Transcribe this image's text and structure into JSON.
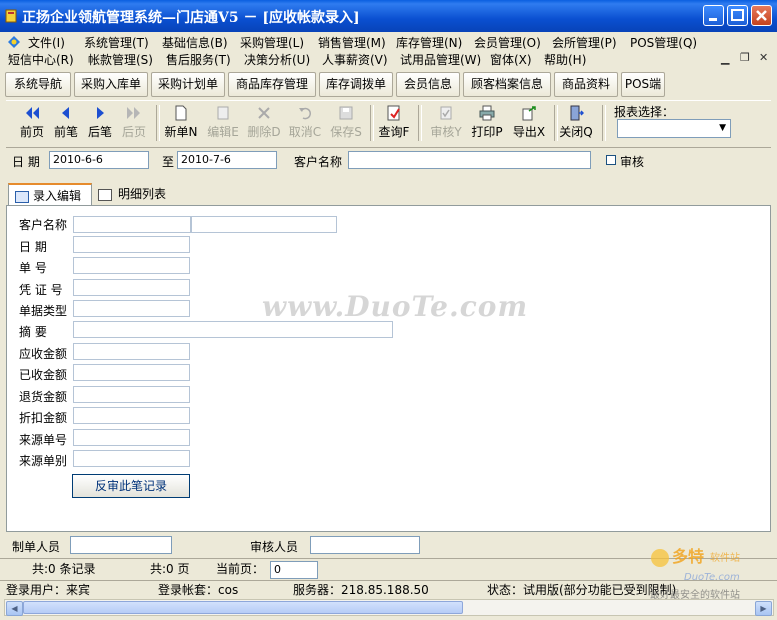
{
  "window": {
    "title": "正扬企业领航管理系统—门店通V5 － [应收帐款录入]"
  },
  "menu": {
    "row1": [
      {
        "label": "文件(I)",
        "key": "file"
      },
      {
        "label": "系统管理(T)",
        "key": "system"
      },
      {
        "label": "基础信息(B)",
        "key": "basic"
      },
      {
        "label": "采购管理(L)",
        "key": "purchase"
      },
      {
        "label": "销售管理(M)",
        "key": "sales"
      },
      {
        "label": "库存管理(N)",
        "key": "stock"
      },
      {
        "label": "会员管理(O)",
        "key": "member"
      },
      {
        "label": "会所管理(P)",
        "key": "club"
      },
      {
        "label": "POS管理(Q)",
        "key": "pos"
      }
    ],
    "row2": [
      {
        "label": "短信中心(R)",
        "key": "sms"
      },
      {
        "label": "帐款管理(S)",
        "key": "accounts"
      },
      {
        "label": "售后服务(T)",
        "key": "aftersales"
      },
      {
        "label": "决策分析(U)",
        "key": "analysis"
      },
      {
        "label": "人事薪资(V)",
        "key": "hr"
      },
      {
        "label": "试用品管理(W)",
        "key": "trial"
      },
      {
        "label": "窗体(X)",
        "key": "window"
      },
      {
        "label": "帮助(H)",
        "key": "help"
      }
    ]
  },
  "nav_tabs": [
    "系统导航",
    "采购入库单",
    "采购计划单",
    "商品库存管理",
    "库存调拨单",
    "会员信息",
    "顾客档案信息",
    "商品资料",
    "POS端"
  ],
  "toolbar": {
    "buttons": [
      {
        "label": "前页",
        "icon": "double-left-arrow-icon",
        "enabled": true
      },
      {
        "label": "前笔",
        "icon": "left-arrow-icon",
        "enabled": true
      },
      {
        "label": "后笔",
        "icon": "right-arrow-icon",
        "enabled": true
      },
      {
        "label": "后页",
        "icon": "double-right-arrow-icon",
        "enabled": false
      },
      {
        "label": "新单N",
        "icon": "new-doc-icon",
        "enabled": true
      },
      {
        "label": "编辑E",
        "icon": "edit-icon",
        "enabled": false
      },
      {
        "label": "删除D",
        "icon": "delete-icon",
        "enabled": false
      },
      {
        "label": "取消C",
        "icon": "undo-icon",
        "enabled": false
      },
      {
        "label": "保存S",
        "icon": "save-icon",
        "enabled": false
      },
      {
        "label": "查询F",
        "icon": "query-icon",
        "enabled": true
      },
      {
        "label": "审核Y",
        "icon": "approve-icon",
        "enabled": false
      },
      {
        "label": "打印P",
        "icon": "print-icon",
        "enabled": true
      },
      {
        "label": "导出X",
        "icon": "export-icon",
        "enabled": true
      },
      {
        "label": "关闭Q",
        "icon": "close-door-icon",
        "enabled": true
      }
    ],
    "report_select_label": "报表选择：",
    "report_select_value": ""
  },
  "filter": {
    "date_label": "日  期",
    "date_from": "2010-6-6",
    "to_label": "至",
    "date_to": "2010-7-6",
    "customer_label": "客户名称",
    "customer_value": "",
    "audit_label": "审核"
  },
  "tabs": {
    "edit": "录入编辑",
    "detail": "明细列表"
  },
  "form": {
    "customer": "客户名称",
    "date": "日    期",
    "number": "单    号",
    "voucher": "凭 证 号",
    "doc_type": "单据类型",
    "summary": "摘    要",
    "receivable": "应收金额",
    "received": "已收金额",
    "returned": "退货金额",
    "discount": "折扣金额",
    "source_no": "来源单号",
    "source_type": "来源单别",
    "review_button": "反审此笔记录"
  },
  "watermark": "www.DuoTe.com",
  "footer": {
    "creator_label": "制单人员",
    "auditor_label": "审核人员",
    "total_records": "共:0 条记录",
    "total_pages": "共:0 页",
    "current_page_label": "当前页：",
    "current_page": "0",
    "login_user": "登录用户：来宾",
    "login_account": "登录帐套：cos",
    "server": "服务器：218.85.188.50",
    "status": "状态：试用版(部分功能已受到限制)"
  },
  "brand_logo": {
    "name": "多特软件站",
    "url_text": "DuoTe.com",
    "slogan": "最好最安全的软件站"
  }
}
